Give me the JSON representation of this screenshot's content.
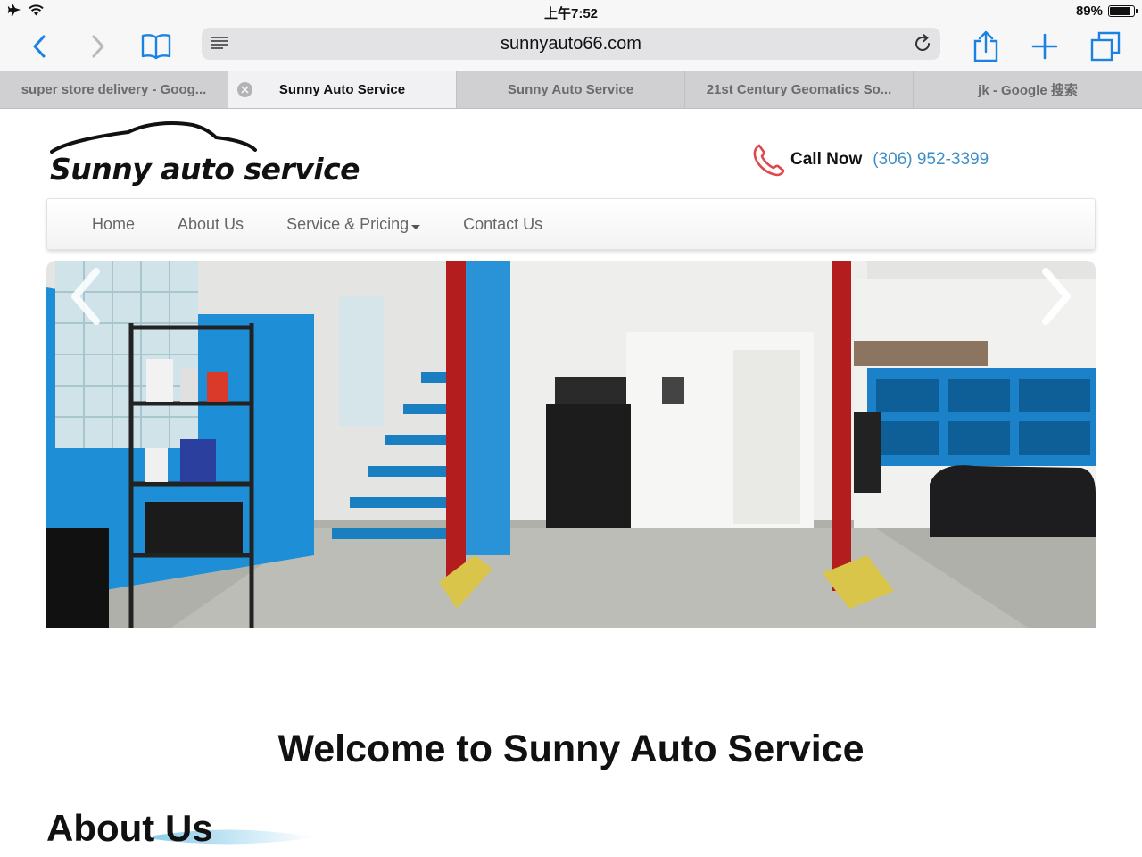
{
  "status_bar": {
    "time": "上午7:52",
    "battery": "89%",
    "battery_level": 0.89,
    "icons": [
      "airplane-icon",
      "wifi-icon",
      "battery-icon"
    ]
  },
  "toolbar": {
    "url": "sunnyauto66.com",
    "buttons": [
      "back-icon",
      "forward-icon",
      "bookmarks-icon",
      "reader-icon",
      "reload-icon",
      "share-icon",
      "new-tab-icon",
      "tabs-icon"
    ]
  },
  "tabs": [
    {
      "title": "super store delivery - Goog...",
      "active": false
    },
    {
      "title": "Sunny Auto Service",
      "active": true
    },
    {
      "title": "Sunny Auto Service",
      "active": false
    },
    {
      "title": "21st Century Geomatics So...",
      "active": false
    },
    {
      "title": "jk - Google 搜索",
      "active": false
    }
  ],
  "site": {
    "logo_text": "Sunny auto service",
    "call_label": "Call Now",
    "phone": "(306) 952-3399",
    "nav": {
      "home": "Home",
      "about": "About Us",
      "service": "Service & Pricing",
      "contact": "Contact Us"
    },
    "carousel": {
      "prev_glyph": "‹",
      "next_glyph": "›"
    },
    "welcome": "Welcome to Sunny Auto Service",
    "about_heading": "About Us"
  },
  "colors": {
    "ios_blue": "#1a82e2",
    "phone_link": "#3d8fc5",
    "call_icon": "#e0464a",
    "wall_blue": "#1e8fd6",
    "lift_red": "#b31d1d"
  }
}
